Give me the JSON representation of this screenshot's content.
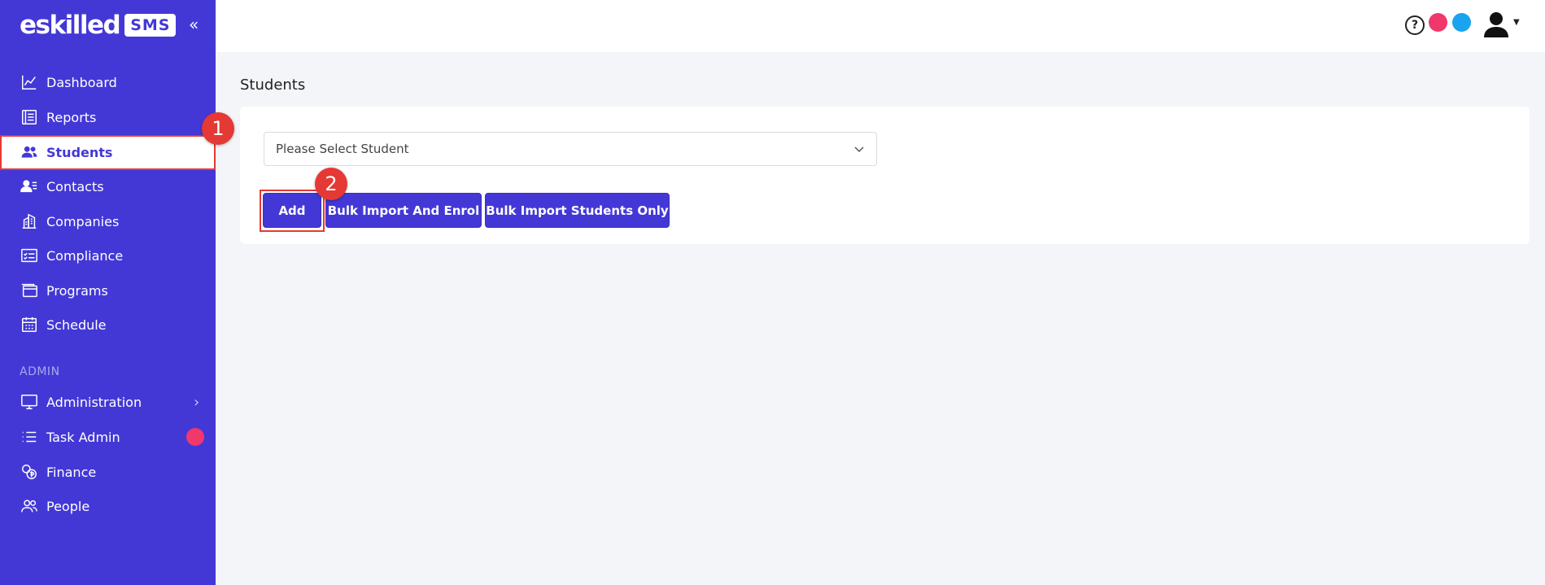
{
  "brand": {
    "name": "eskilled",
    "badge": "SMS"
  },
  "sidebar": {
    "main_items": [
      {
        "label": "Dashboard",
        "icon": "chart-line-icon"
      },
      {
        "label": "Reports",
        "icon": "report-icon"
      },
      {
        "label": "Students",
        "icon": "users-icon",
        "active": true
      },
      {
        "label": "Contacts",
        "icon": "contacts-icon"
      },
      {
        "label": "Companies",
        "icon": "building-icon"
      },
      {
        "label": "Compliance",
        "icon": "checklist-icon"
      },
      {
        "label": "Programs",
        "icon": "window-icon"
      },
      {
        "label": "Schedule",
        "icon": "calendar-icon"
      }
    ],
    "admin_label": "ADMIN",
    "admin_items": [
      {
        "label": "Administration",
        "icon": "monitor-icon"
      },
      {
        "label": "Task Admin",
        "icon": "list-icon"
      },
      {
        "label": "Finance",
        "icon": "coins-icon"
      },
      {
        "label": "People",
        "icon": "people-icon"
      }
    ]
  },
  "topbar": {
    "help": "?"
  },
  "colors": {
    "accent": "#4338d6",
    "dot_pink": "#f0386b",
    "dot_blue": "#1aa3ef",
    "annotation": "#e53935"
  },
  "main": {
    "page_title": "Students",
    "select_placeholder": "Please Select Student",
    "buttons": {
      "add": "Add",
      "bulk_enrol": "Bulk Import And Enrol",
      "bulk_students": "Bulk Import Students Only"
    }
  },
  "annotations": {
    "first": "1",
    "second": "2"
  }
}
